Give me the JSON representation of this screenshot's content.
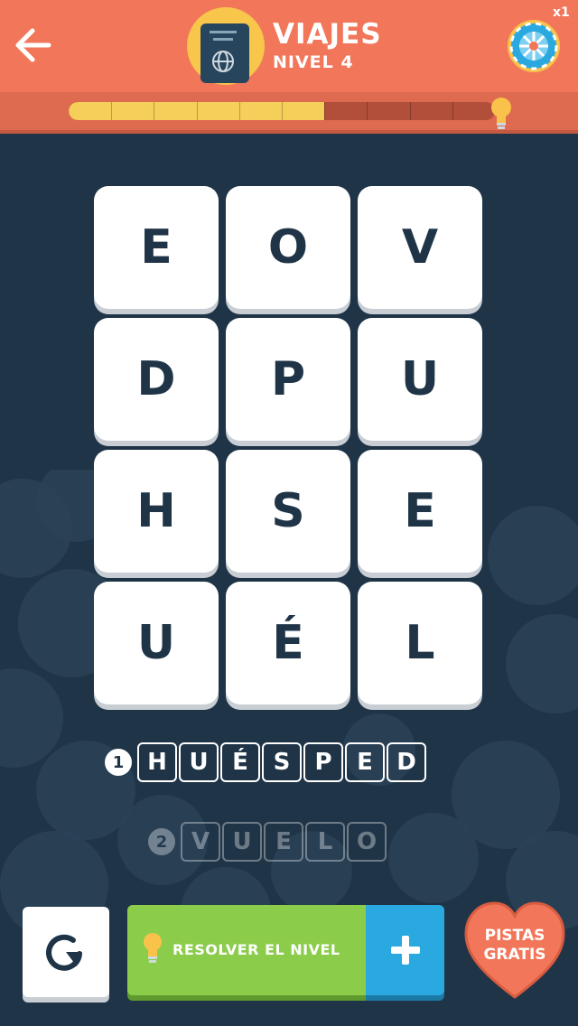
{
  "header": {
    "title": "VIAJES",
    "subtitle": "NIVEL 4",
    "wheel_multiplier": "x1",
    "back_icon": "arrow-left-icon",
    "category_icon": "passport-icon",
    "wheel_icon": "prize-wheel-icon"
  },
  "progress": {
    "filled_segments": 6,
    "total_segments": 10,
    "end_icon": "lightbulb-icon"
  },
  "grid": {
    "rows": [
      [
        "E",
        "O",
        "V"
      ],
      [
        "D",
        "P",
        "U"
      ],
      [
        "H",
        "S",
        "E"
      ],
      [
        "U",
        "É",
        "L"
      ]
    ]
  },
  "answers": [
    {
      "number": "1",
      "letters": [
        "H",
        "U",
        "É",
        "S",
        "P",
        "E",
        "D"
      ],
      "solved": true
    },
    {
      "number": "2",
      "letters": [
        "V",
        "U",
        "E",
        "L",
        "O"
      ],
      "solved": false
    }
  ],
  "controls": {
    "reset_icon": "restart-icon",
    "solve_label": "RESOLVER EL NIVEL",
    "solve_icon": "lightbulb-icon",
    "plus_icon": "plus-icon",
    "free_hints_line1": "PISTAS",
    "free_hints_line2": "GRATIS"
  },
  "colors": {
    "header": "#f2775a",
    "background": "#1f3447",
    "progress_fill": "#f6cf5a",
    "solve_button": "#8bcc4b",
    "plus_button": "#2aa8e0",
    "heart": "#f2775a"
  }
}
